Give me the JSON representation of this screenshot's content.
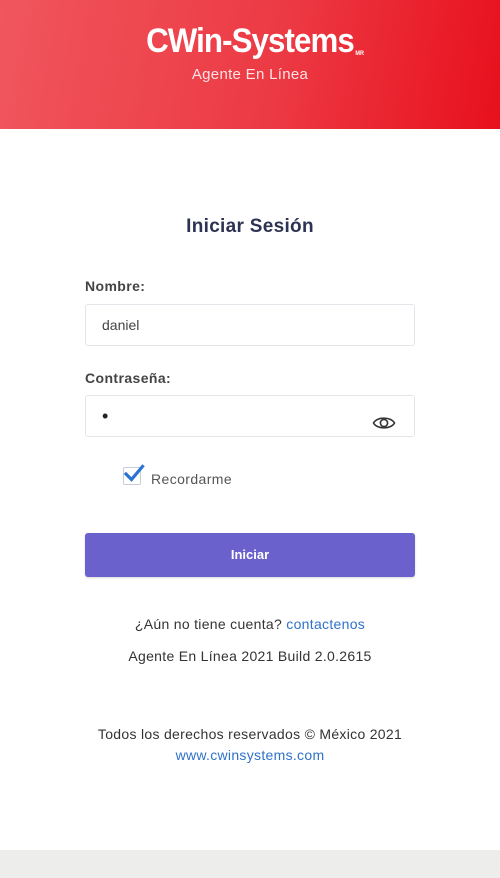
{
  "header": {
    "logo_text": "CWin-Systems",
    "logo_mark": "MR",
    "subtitle": "Agente En Línea"
  },
  "login": {
    "title": "Iniciar Sesión",
    "username_label": "Nombre:",
    "username_value": "daniel",
    "password_label": "Contraseña:",
    "password_masked": "•",
    "remember_label": "Recordarme",
    "remember_checked": true,
    "submit_label": "Iniciar"
  },
  "footer": {
    "account_prompt": "¿Aún no tiene cuenta?",
    "contact_link": "contactenos",
    "build_info": "Agente En Línea 2021 Build 2.0.2615",
    "rights": "Todos los derechos reservados © México 2021",
    "website": "www.cwinsystems.com"
  },
  "colors": {
    "header_start": "#f0565e",
    "header_end": "#e8101d",
    "button": "#6a61cd",
    "link": "#2f72c9",
    "checkbox": "#2a72d6"
  },
  "icons": {
    "password_toggle": "eye-icon",
    "remember_check": "checkmark-icon"
  }
}
